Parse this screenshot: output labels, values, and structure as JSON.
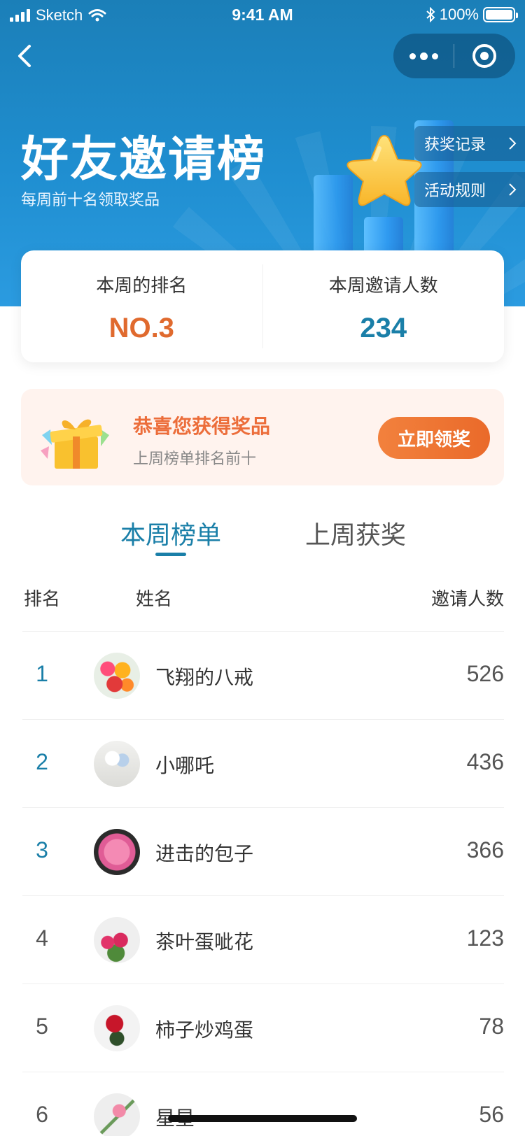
{
  "status_bar": {
    "carrier": "Sketch",
    "time": "9:41 AM",
    "battery": "100%"
  },
  "header": {
    "title": "好友邀请榜",
    "subtitle": "每周前十名领取奖品",
    "links": [
      {
        "label": "获奖记录"
      },
      {
        "label": "活动规则"
      }
    ]
  },
  "stats": {
    "rank_label": "本周的排名",
    "rank_value": "NO.3",
    "invite_label": "本周邀请人数",
    "invite_value": "234",
    "rank_color": "#e06a2e",
    "invite_color": "#1a7fa8"
  },
  "prize": {
    "title": "恭喜您获得奖品",
    "subtitle": "上周榜单排名前十",
    "button_label": "立即领奖"
  },
  "tabs": [
    {
      "label": "本周榜单",
      "active": true
    },
    {
      "label": "上周获奖",
      "active": false
    }
  ],
  "table": {
    "headers": {
      "rank": "排名",
      "name": "姓名",
      "count": "邀请人数"
    },
    "rows": [
      {
        "rank": "1",
        "name": "飞翔的八戒",
        "count": "526"
      },
      {
        "rank": "2",
        "name": "小哪吒",
        "count": "436"
      },
      {
        "rank": "3",
        "name": "进击的包子",
        "count": "366"
      },
      {
        "rank": "4",
        "name": "茶叶蛋呲花",
        "count": "123"
      },
      {
        "rank": "5",
        "name": "柿子炒鸡蛋",
        "count": "78"
      },
      {
        "rank": "6",
        "name": "星星",
        "count": "56"
      }
    ]
  },
  "colors": {
    "accent": "#1a7fa8",
    "orange": "#ec6d3a",
    "header_blue": "#1f8ed0"
  }
}
